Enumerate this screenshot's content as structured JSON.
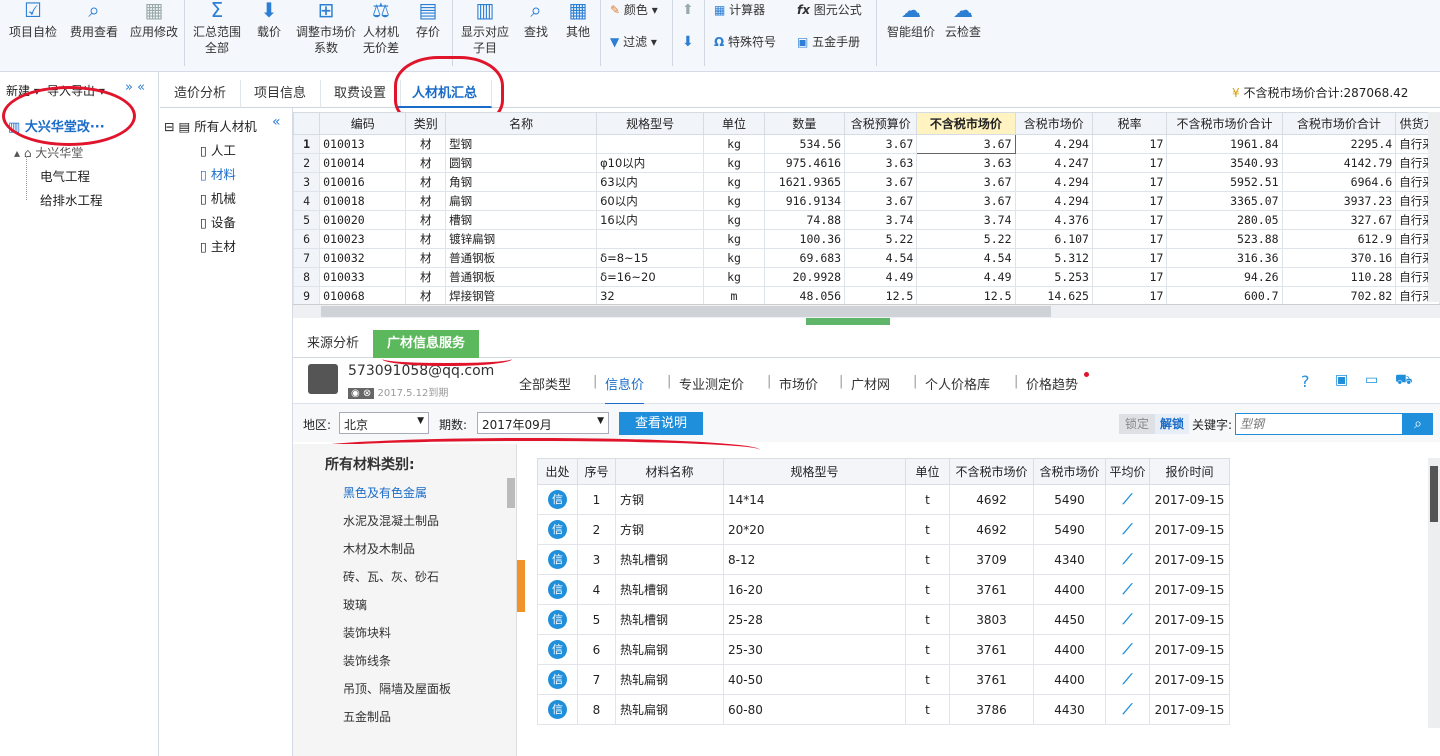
{
  "toolbar": {
    "buttons": [
      {
        "label": "项目自检",
        "icon": "check-icon"
      },
      {
        "label": "费用查看",
        "icon": "cost-view-icon"
      },
      {
        "label": "应用修改",
        "icon": "apply-icon"
      },
      {
        "label": "汇总范围\n全部",
        "icon": "summary-icon"
      },
      {
        "label": "载价",
        "icon": "load-price-icon"
      },
      {
        "label": "调整市场价\n系数",
        "icon": "adjust-icon"
      },
      {
        "label": "人材机\n无价差",
        "icon": "balance-icon"
      },
      {
        "label": "存价",
        "icon": "save-price-icon"
      },
      {
        "label": "显示对应\n子目",
        "icon": "show-sub-icon"
      },
      {
        "label": "查找",
        "icon": "binoculars-icon"
      },
      {
        "label": "其他",
        "icon": "grid-icon"
      }
    ],
    "small": {
      "color": "颜色",
      "filter": "过滤",
      "calculator": "计算器",
      "formula": "图元公式",
      "special": "特殊符号",
      "hardware": "五金手册"
    },
    "right": [
      {
        "label": "智能组价"
      },
      {
        "label": "云检查"
      }
    ]
  },
  "left": {
    "new": "新建",
    "import": "导入导出",
    "project": "大兴华堂改···",
    "sub": "大兴华堂",
    "items": [
      "电气工程",
      "给排水工程"
    ]
  },
  "tabs": [
    "造价分析",
    "项目信息",
    "取费设置",
    "人材机汇总"
  ],
  "total_label": "不含税市场价合计:287068.42",
  "tree": {
    "root": "所有人材机",
    "items": [
      "人工",
      "材料",
      "机械",
      "设备",
      "主材"
    ]
  },
  "grid": {
    "headers": [
      "编码",
      "类别",
      "名称",
      "规格型号",
      "单位",
      "数量",
      "含税预算价",
      "不含税市场价",
      "含税市场价",
      "税率",
      "不含税市场价合计",
      "含税市场价合计",
      "供货方"
    ],
    "rows": [
      [
        "1",
        "010013",
        "材",
        "型钢",
        "",
        "kg",
        "534.56",
        "3.67",
        "3.67",
        "4.294",
        "17",
        "1961.84",
        "2295.4",
        "自行采"
      ],
      [
        "2",
        "010014",
        "材",
        "圆钢",
        "φ10以内",
        "kg",
        "975.4616",
        "3.63",
        "3.63",
        "4.247",
        "17",
        "3540.93",
        "4142.79",
        "自行采"
      ],
      [
        "3",
        "010016",
        "材",
        "角钢",
        "63以内",
        "kg",
        "1621.9365",
        "3.67",
        "3.67",
        "4.294",
        "17",
        "5952.51",
        "6964.6",
        "自行采"
      ],
      [
        "4",
        "010018",
        "材",
        "扁钢",
        "60以内",
        "kg",
        "916.9134",
        "3.67",
        "3.67",
        "4.294",
        "17",
        "3365.07",
        "3937.23",
        "自行采"
      ],
      [
        "5",
        "010020",
        "材",
        "槽钢",
        "16以内",
        "kg",
        "74.88",
        "3.74",
        "3.74",
        "4.376",
        "17",
        "280.05",
        "327.67",
        "自行采"
      ],
      [
        "6",
        "010023",
        "材",
        "镀锌扁钢",
        "",
        "kg",
        "100.36",
        "5.22",
        "5.22",
        "6.107",
        "17",
        "523.88",
        "612.9",
        "自行采"
      ],
      [
        "7",
        "010032",
        "材",
        "普通钢板",
        "δ=8~15",
        "kg",
        "69.683",
        "4.54",
        "4.54",
        "5.312",
        "17",
        "316.36",
        "370.16",
        "自行采"
      ],
      [
        "8",
        "010033",
        "材",
        "普通钢板",
        "δ=16~20",
        "kg",
        "20.9928",
        "4.49",
        "4.49",
        "5.253",
        "17",
        "94.26",
        "110.28",
        "自行采"
      ],
      [
        "9",
        "010068",
        "材",
        "焊接钢管",
        "32",
        "m",
        "48.056",
        "12.5",
        "12.5",
        "14.625",
        "17",
        "600.7",
        "702.82",
        "自行采"
      ]
    ]
  },
  "lower_tabs": [
    "来源分析",
    "广材信息服务"
  ],
  "user": {
    "email": "573091058@qq.com",
    "expire": "2017.5.12到期"
  },
  "nav": [
    "全部类型",
    "信息价",
    "专业测定价",
    "市场价",
    "广材网",
    "个人价格库",
    "价格趋势"
  ],
  "filter": {
    "region_label": "地区:",
    "region": "北京",
    "period_label": "期数:",
    "period": "2017年09月",
    "explain": "查看说明",
    "lock": "锁定",
    "unlock": "解锁",
    "keyword_label": "关键字:",
    "keyword_placeholder": "型钢"
  },
  "categories": {
    "title": "所有材料类别:",
    "items": [
      "黑色及有色金属",
      "水泥及混凝土制品",
      "木材及木制品",
      "砖、瓦、灰、砂石",
      "玻璃",
      "装饰块料",
      "装饰线条",
      "吊顶、隔墙及屋面板",
      "五金制品"
    ]
  },
  "prices": {
    "headers": [
      "出处",
      "序号",
      "材料名称",
      "规格型号",
      "单位",
      "不含税市场价",
      "含税市场价",
      "平均价",
      "报价时间"
    ],
    "source_label": "信",
    "rows": [
      [
        "1",
        "方钢",
        "14*14",
        "t",
        "4692",
        "5490",
        "2017-09-15"
      ],
      [
        "2",
        "方钢",
        "20*20",
        "t",
        "4692",
        "5490",
        "2017-09-15"
      ],
      [
        "3",
        "热轧槽钢",
        "8-12",
        "t",
        "3709",
        "4340",
        "2017-09-15"
      ],
      [
        "4",
        "热轧槽钢",
        "16-20",
        "t",
        "3761",
        "4400",
        "2017-09-15"
      ],
      [
        "5",
        "热轧槽钢",
        "25-28",
        "t",
        "3803",
        "4450",
        "2017-09-15"
      ],
      [
        "6",
        "热轧扁钢",
        "25-30",
        "t",
        "3761",
        "4400",
        "2017-09-15"
      ],
      [
        "7",
        "热轧扁钢",
        "40-50",
        "t",
        "3761",
        "4400",
        "2017-09-15"
      ],
      [
        "8",
        "热轧扁钢",
        "60-80",
        "t",
        "3786",
        "4430",
        "2017-09-15"
      ]
    ]
  }
}
